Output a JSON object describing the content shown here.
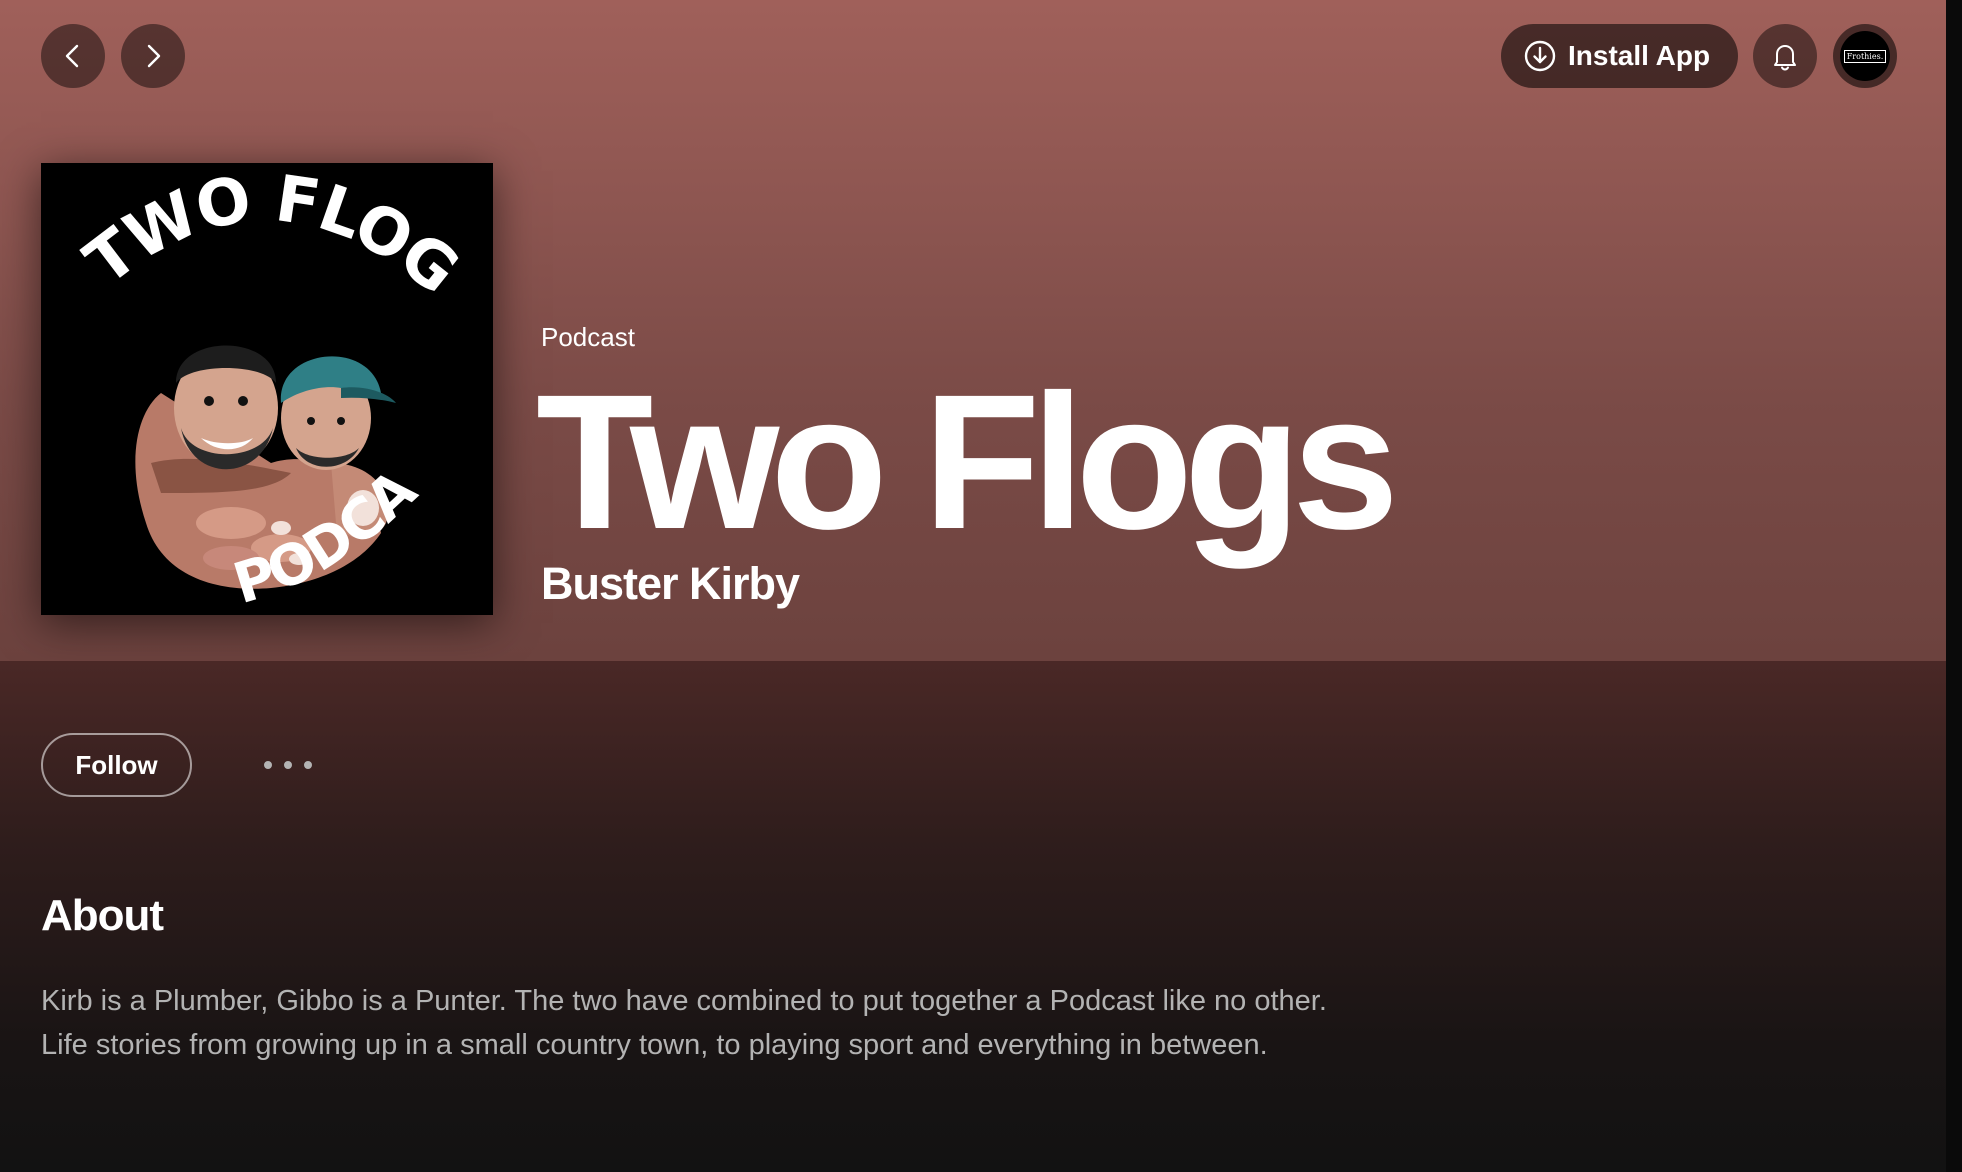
{
  "topbar": {
    "install_label": "Install App",
    "avatar_text": "Frothies."
  },
  "icons": {
    "back": "chevron-left-icon",
    "forward": "chevron-right-icon",
    "install": "download-circle-icon",
    "notifications": "bell-icon",
    "more": "more-horizontal-icon"
  },
  "header": {
    "type_label": "Podcast",
    "title": "Two Flogs",
    "publisher": "Buster Kirby"
  },
  "cover_art": {
    "top_text": "TWO FLOGS",
    "bottom_text": "PODCAST"
  },
  "actions": {
    "follow_label": "Follow"
  },
  "about": {
    "heading": "About",
    "line1": "Kirb is a Plumber, Gibbo is a Punter. The two have combined to put together a Podcast like no other.",
    "line2": "Life stories from growing up in a small country town, to playing sport and everything in between."
  },
  "colors": {
    "hero_top": "#a0605a",
    "hero_bottom": "#6c423e",
    "lower_top": "#4a2826",
    "page_bg": "#121212",
    "text_muted": "#b3b3b3"
  }
}
